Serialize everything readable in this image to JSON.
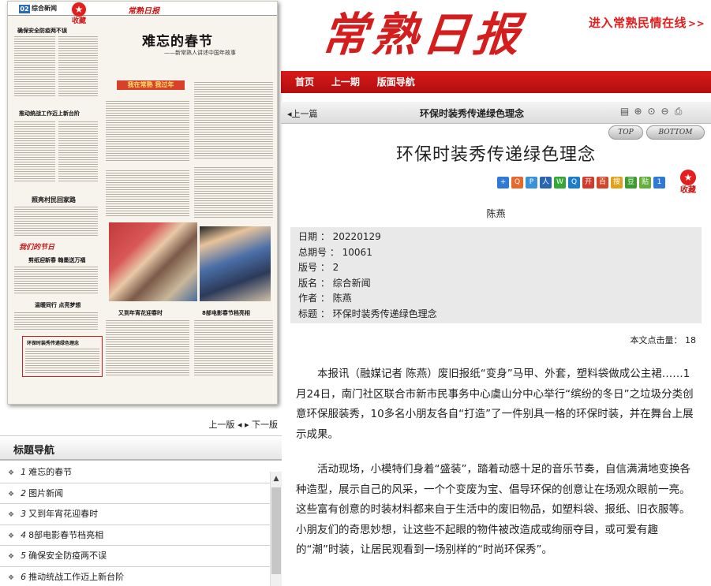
{
  "header": {
    "logo_text": "常熟日报",
    "civic_link": "进入常熟民情在线",
    "civic_arrow": ">>"
  },
  "nav": {
    "items": [
      "首页",
      "上一期",
      "版面导航"
    ]
  },
  "paper_thumb": {
    "page_num": "02",
    "section": "综合新闻",
    "mini_logo": "常熟日报",
    "star_label": "收藏",
    "headline": "难忘的春节",
    "subline": "——新常熟人讲述中国年故事",
    "banner": "我在常熟 我过年",
    "left_headlines": [
      "确保安全防疫两不误",
      "推动统战工作迈上新台阶",
      "照亮村民回家路",
      "剪纸迎新春 翰墨送万福",
      "温暖同行 点亮梦想",
      "环保时装秀传递绿色理念"
    ],
    "mid_headlines": [
      "又到年宵花迎春时",
      "8部电影春节档亮相"
    ],
    "section_logo": "我们的节日"
  },
  "paper_pager": {
    "prev": "上一版",
    "next": "下一版"
  },
  "title_nav": {
    "label": "标题导航",
    "items": [
      {
        "num": "1",
        "title": "难忘的春节"
      },
      {
        "num": "2",
        "title": "图片新闻"
      },
      {
        "num": "3",
        "title": "又到年宵花迎春时"
      },
      {
        "num": "4",
        "title": "8部电影春节档亮相"
      },
      {
        "num": "5",
        "title": "确保安全防疫两不误"
      },
      {
        "num": "6",
        "title": "推动统战工作迈上新台阶"
      }
    ]
  },
  "article_toolbar": {
    "prev_link": "上一篇",
    "title": "环保时装秀传递绿色理念",
    "icons": [
      "copy-icon",
      "zoom-in-icon",
      "zoom-reset-icon",
      "zoom-out-icon",
      "print-icon"
    ]
  },
  "page_buttons": {
    "top": "TOP",
    "bottom": "BOTTOM"
  },
  "article": {
    "title": "环保时装秀传递绿色理念",
    "author": "陈燕",
    "fav_label": "收藏",
    "share_icons": [
      {
        "name": "share-plus-icon",
        "color": "#2f7ad8",
        "glyph": "+"
      },
      {
        "name": "share-qzone-icon",
        "color": "#e8672a",
        "glyph": "Q"
      },
      {
        "name": "share-weibo-icon",
        "color": "#3a93d6",
        "glyph": "P"
      },
      {
        "name": "share-renren-icon",
        "color": "#2a64b5",
        "glyph": "人"
      },
      {
        "name": "share-wechat-icon",
        "color": "#33a936",
        "glyph": "W"
      },
      {
        "name": "share-tqq-icon",
        "color": "#1b7ec8",
        "glyph": "Q"
      },
      {
        "name": "share-kaixin-icon",
        "color": "#d23a2a",
        "glyph": "开"
      },
      {
        "name": "share-baidu-icon",
        "color": "#d6442b",
        "glyph": "百"
      },
      {
        "name": "share-sohu-icon",
        "color": "#e0a21c",
        "glyph": "搜"
      },
      {
        "name": "share-douban-icon",
        "color": "#3c9c2f",
        "glyph": "豆"
      },
      {
        "name": "share-tieba-icon",
        "color": "#62b03a",
        "glyph": "贴"
      },
      {
        "name": "share-count-icon",
        "color": "#2f7ad8",
        "glyph": "1"
      }
    ],
    "meta": [
      {
        "label": "日期",
        "value": "20220129"
      },
      {
        "label": "总期号",
        "value": "10061"
      },
      {
        "label": "版号",
        "value": "2"
      },
      {
        "label": "版名",
        "value": "综合新闻"
      },
      {
        "label": "作者",
        "value": "陈燕"
      },
      {
        "label": "标题",
        "value": "环保时装秀传递绿色理念"
      }
    ],
    "clicks_label": "本文点击量：",
    "clicks_value": "18",
    "paragraphs": [
      "本报讯（融媒记者 陈燕）废旧报纸“变身”马甲、外套，塑料袋做成公主裙……1月24日，南门社区联合市新市民事务中心虞山分中心举行“缤纷的冬日”之垃圾分类创意环保服装秀，10多名小朋友各自“打造”了一件别具一格的环保时装，并在舞台上展示成果。",
      "活动现场，小模特们身着“盛装”，踏着动感十足的音乐节奏，自信满满地变换各种造型，展示自己的风采，一个个变废为宝、倡导环保的创意让在场观众眼前一亮。这些富有创意的时装材料都来自于生活中的废旧物品，如塑料袋、报纸、旧衣服等。小朋友们的奇思妙想，让这些不起眼的物件被改造成或绚丽夺目，或可爱有趣的“潮”时装，让居民观看到一场别样的“时尚环保秀”。"
    ]
  },
  "colors": {
    "brand_red": "#d41e1e",
    "nav_red": "#c41414",
    "meta_bg": "#e9e9e9"
  }
}
